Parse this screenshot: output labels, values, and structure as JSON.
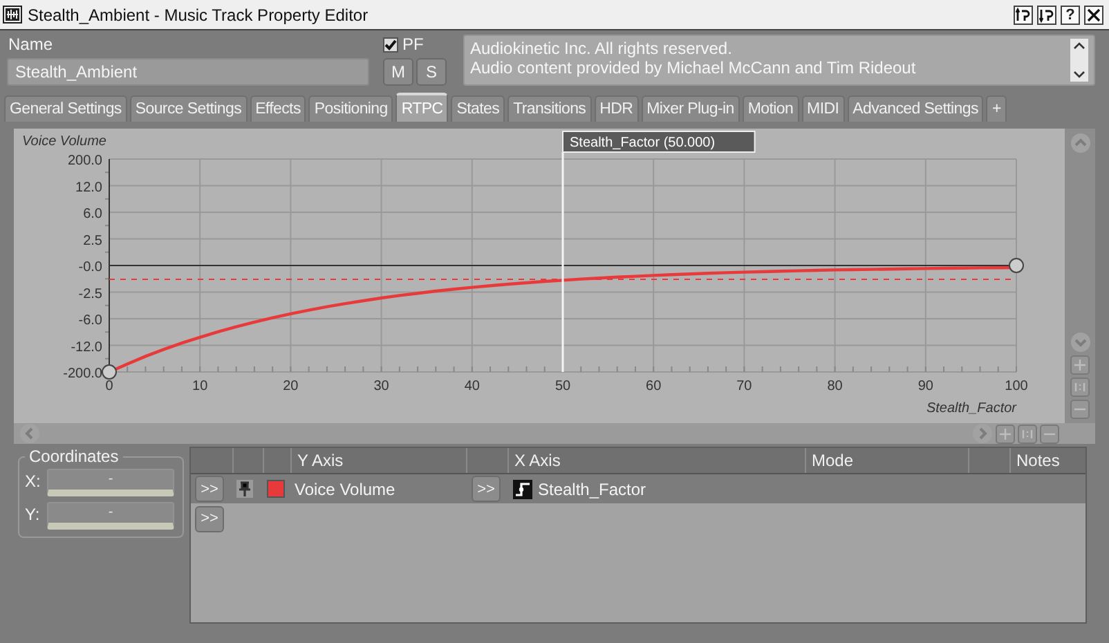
{
  "window": {
    "title": "Stealth_Ambient - Music Track Property Editor",
    "help": "?"
  },
  "name": {
    "label": "Name",
    "value": "Stealth_Ambient"
  },
  "pf": {
    "label": "PF",
    "checked": true
  },
  "mute_solo": [
    "M",
    "S"
  ],
  "notes": [
    "Audiokinetic Inc. All rights reserved.",
    "Audio content provided by Michael McCann and Tim Rideout"
  ],
  "tabs": [
    {
      "label": "General Settings",
      "selected": false
    },
    {
      "label": "Source Settings",
      "selected": false
    },
    {
      "label": "Effects",
      "selected": false
    },
    {
      "label": "Positioning",
      "selected": false
    },
    {
      "label": "RTPC",
      "selected": true
    },
    {
      "label": "States",
      "selected": false
    },
    {
      "label": "Transitions",
      "selected": false
    },
    {
      "label": "HDR",
      "selected": false
    },
    {
      "label": "Mixer Plug-in",
      "selected": false
    },
    {
      "label": "Motion",
      "selected": false
    },
    {
      "label": "MIDI",
      "selected": false
    },
    {
      "label": "Advanced Settings",
      "selected": false
    },
    {
      "label": "+",
      "selected": false
    }
  ],
  "graph": {
    "y_axis_label": "Voice Volume",
    "x_axis_label": "Stealth_Factor",
    "y_tick_labels": [
      "200.0",
      "12.0",
      "6.0",
      "2.5",
      "-0.0",
      "-2.5",
      "-6.0",
      "-12.0",
      "-200.0"
    ],
    "x_tick_labels": [
      "0",
      "10",
      "20",
      "30",
      "40",
      "50",
      "60",
      "70",
      "80",
      "90",
      "100"
    ],
    "cursor_label": "Stealth_Factor (50.000)"
  },
  "coordinates": {
    "title": "Coordinates",
    "fields": [
      {
        "label": "X:",
        "value": "-"
      },
      {
        "label": "Y:",
        "value": "-"
      }
    ]
  },
  "rtpc_table": {
    "columns": [
      "Y Axis",
      "X Axis",
      "Mode",
      "Notes"
    ],
    "rows": [
      {
        "y_button": ">>",
        "y_axis": "Voice Volume",
        "color": "#e83a3a",
        "x_button": ">>",
        "x_axis": "Stealth_Factor"
      }
    ],
    "add_button": ">>"
  }
}
